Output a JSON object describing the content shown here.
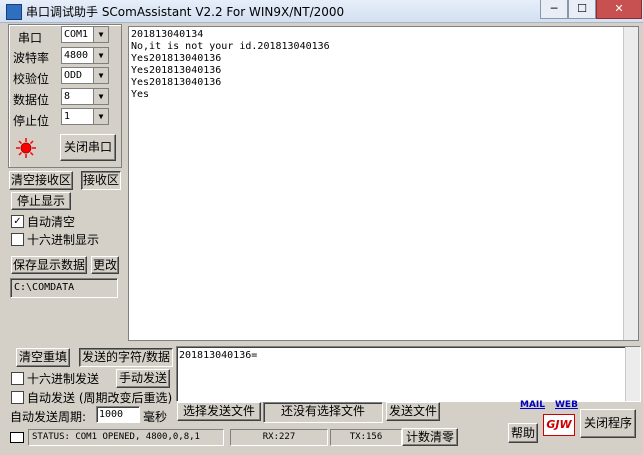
{
  "window": {
    "title": "串口调试助手 SComAssistant V2.2 For WIN9X/NT/2000",
    "min_icon": "─",
    "max_icon": "☐",
    "close_icon": "✕"
  },
  "port_settings": {
    "port_label": "串口",
    "port_value": "COM1",
    "baud_label": "波特率",
    "baud_value": "4800",
    "parity_label": "校验位",
    "parity_value": "ODD",
    "databits_label": "数据位",
    "databits_value": "8",
    "stopbits_label": "停止位",
    "stopbits_value": "1",
    "close_port_button": "关闭串口",
    "indicator_color": "#ff0000"
  },
  "receive": {
    "clear_button": "清空接收区",
    "area_label": "接收区",
    "stop_display_button": "停止显示",
    "auto_clear_label": "自动清空",
    "auto_clear_checked": "✓",
    "hex_display_label": "十六进制显示",
    "save_button": "保存显示数据",
    "change_button": "更改",
    "save_path": "C:\\COMDATA",
    "lines": [
      "201813040134",
      "No,it is not your id.201813040136",
      "Yes201813040136",
      "Yes201813040136",
      "Yes201813040136",
      "Yes"
    ]
  },
  "send": {
    "clear_reset_button": "清空重填",
    "send_data_label": "发送的字符/数据",
    "hex_send_label": "十六进制发送",
    "manual_send_button": "手动发送",
    "auto_send_label": "自动发送 (周期改变后重选)",
    "auto_period_label": "自动发送周期:",
    "period_value": "1000",
    "ms_label": "毫秒",
    "text": "201813040136=",
    "select_file_button": "选择发送文件",
    "no_file_label": "还没有选择文件",
    "send_file_button": "发送文件",
    "mail_link": "MAIL",
    "web_link": "WEB",
    "help_button": "帮助",
    "logo_text": "GJW",
    "close_app_button": "关闭程序"
  },
  "status": {
    "text": "STATUS: COM1 OPENED, 4800,0,8,1",
    "rx": "RX:227",
    "tx": "TX:156",
    "reset_count_button": "计数清零"
  },
  "colors": {
    "background": "#d4d0c8",
    "link": "#0000c0",
    "close": "#c75050"
  }
}
